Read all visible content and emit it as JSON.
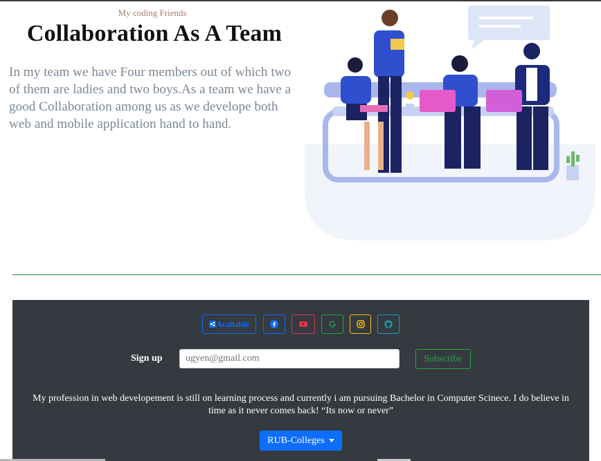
{
  "hero": {
    "eyebrow": "My coding Friends",
    "title": "Collaboration As A Team",
    "paragraph": "In my team we have Four members out of which two of them are ladies and two boys.As a team we have a good Collaboration among us as we develope both web and mobile application hand to hand."
  },
  "illustration": {
    "icon": "team-collaboration-illustration"
  },
  "footer": {
    "social": {
      "available_label": "Available",
      "buttons": [
        {
          "name": "facebook",
          "icon": "facebook-icon",
          "color": "#0d6efd"
        },
        {
          "name": "youtube",
          "icon": "youtube-icon",
          "color": "#dc3545"
        },
        {
          "name": "google",
          "icon": "google-icon",
          "color": "#28a745"
        },
        {
          "name": "instagram",
          "icon": "instagram-icon",
          "color": "#ffc107"
        },
        {
          "name": "github",
          "icon": "github-icon",
          "color": "#17a2b8"
        }
      ]
    },
    "signup": {
      "label": "Sign up",
      "email_value": "",
      "email_placeholder": "ugyen@gmail.com",
      "subscribe_label": "Subscribe"
    },
    "text": "My profession in web developement is still on learning process and currently i am pursuing Bachelor in Computer Scinece. I do believe in time as it never comes back! “Its now or never”",
    "dropdown_label": "RUB-Colleges"
  },
  "colors": {
    "footer_bg": "#343a40",
    "primary": "#0d6efd",
    "success": "#28a745",
    "divider": "#2f7a3b"
  }
}
